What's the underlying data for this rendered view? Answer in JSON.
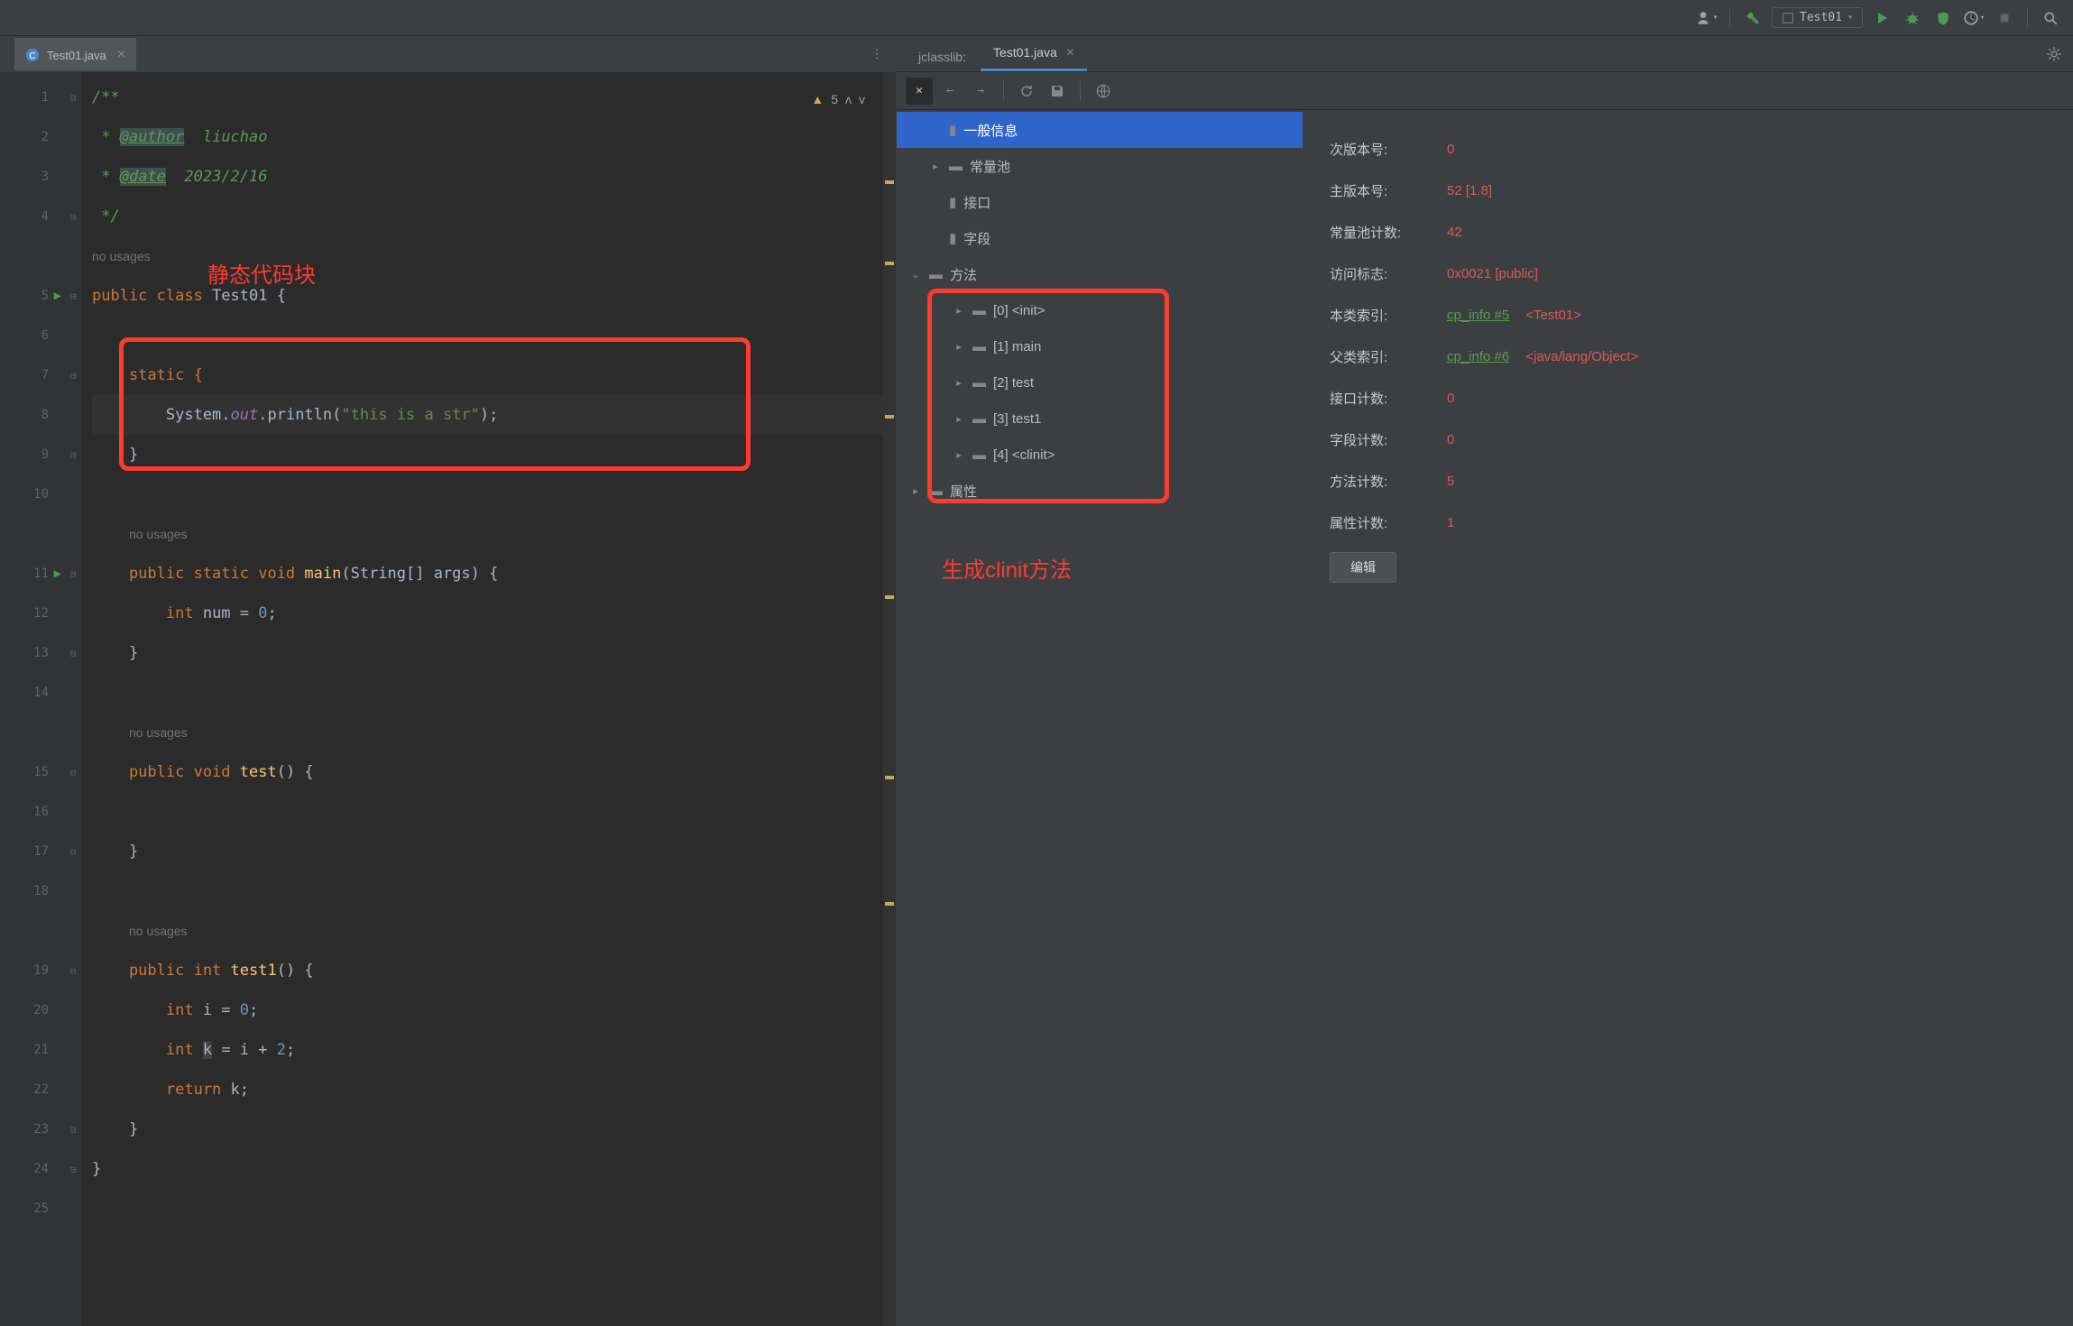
{
  "toolbar": {
    "run_config": "Test01"
  },
  "editor": {
    "tab": "Test01.java",
    "warnings": "5",
    "lines": [
      "1",
      "2",
      "3",
      "4",
      "",
      "5",
      "6",
      "7",
      "8",
      "9",
      "10",
      "",
      "11",
      "12",
      "13",
      "14",
      "",
      "15",
      "16",
      "17",
      "18",
      "",
      "19",
      "20",
      "21",
      "22",
      "23",
      "24",
      "25"
    ],
    "hint_nousages": "no usages",
    "code": {
      "l1": "/**",
      "l2a": " * ",
      "l2b": "@author",
      "l2c": "  liuchao",
      "l3a": " * ",
      "l3b": "@date",
      "l3c": "  2023/2/16",
      "l4": " */",
      "l5a": "public class ",
      "l5b": "Test01",
      "l5c": " {",
      "l7": "    static {",
      "l8a": "        System.",
      "l8b": "out",
      "l8c": ".println(",
      "l8d": "\"this is a str\"",
      "l8e": ");",
      "l9": "    }",
      "l11a": "    public static void ",
      "l11b": "main",
      "l11c": "(String[] args) {",
      "l12a": "        int ",
      "l12b": "num",
      "l12c": " = ",
      "l12d": "0",
      "l12e": ";",
      "l13": "    }",
      "l15a": "    public void ",
      "l15b": "test",
      "l15c": "() {",
      "l17": "    }",
      "l19a": "    public int ",
      "l19b": "test1",
      "l19c": "() {",
      "l20a": "        int ",
      "l20b": "i = ",
      "l20c": "0",
      "l20d": ";",
      "l21a": "        int ",
      "l21b": "k",
      "l21c": " = i + ",
      "l21d": "2",
      "l21e": ";",
      "l22a": "        return ",
      "l22b": "k;",
      "l23": "    }",
      "l24": "}"
    },
    "annotation1": "静态代码块",
    "annotation2": "生成clinit方法"
  },
  "jclasslib": {
    "tab_label": "jclasslib:",
    "tab_file": "Test01.java",
    "tree": {
      "general": "一般信息",
      "constant_pool": "常量池",
      "interfaces": "接口",
      "fields": "字段",
      "methods": "方法",
      "m0": "[0] <init>",
      "m1": "[1] main",
      "m2": "[2] test",
      "m3": "[3] test1",
      "m4": "[4] <clinit>",
      "attributes": "属性"
    },
    "details": {
      "minor_label": "次版本号:",
      "minor_val": "0",
      "major_label": "主版本号:",
      "major_val": "52 [1.8]",
      "cpcount_label": "常量池计数:",
      "cpcount_val": "42",
      "access_label": "访问标志:",
      "access_val": "0x0021 [public]",
      "thisclass_label": "本类索引:",
      "thisclass_link": "cp_info #5",
      "thisclass_val": "<Test01>",
      "superclass_label": "父类索引:",
      "superclass_link": "cp_info #6",
      "superclass_val": "<java/lang/Object>",
      "ifcount_label": "接口计数:",
      "ifcount_val": "0",
      "fieldcount_label": "字段计数:",
      "fieldcount_val": "0",
      "methodcount_label": "方法计数:",
      "methodcount_val": "5",
      "attrcount_label": "属性计数:",
      "attrcount_val": "1",
      "edit_btn": "编辑"
    }
  }
}
